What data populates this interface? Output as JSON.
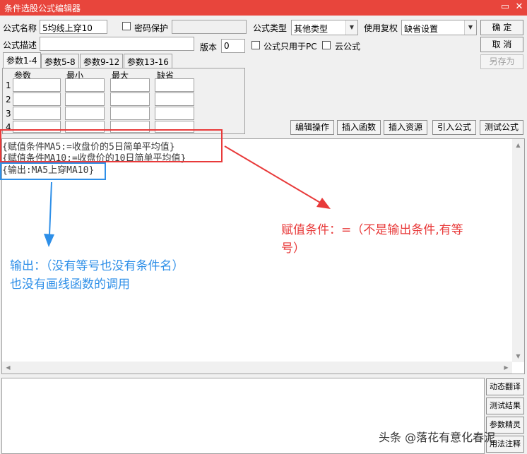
{
  "window": {
    "title": "条件选股公式编辑器",
    "minimize_glyph": "▭",
    "close_glyph": "✕"
  },
  "form": {
    "name_label": "公式名称",
    "name_value": "5均线上穿10",
    "password_label": "密码保护",
    "password_value": "",
    "type_label": "公式类型",
    "type_value": "其他类型",
    "fuquan_label": "使用复权",
    "fuquan_value": "缺省设置",
    "desc_label": "公式描述",
    "desc_value": "",
    "version_label": "版本",
    "version_value": "0",
    "pc_only_label": "公式只用于PC",
    "cloud_label": "云公式"
  },
  "buttons": {
    "ok": "确  定",
    "cancel": "取  消",
    "save_as": "另存为",
    "edit_ops": "编辑操作",
    "insert_func": "插入函数",
    "insert_res": "插入资源",
    "import_formula": "引入公式",
    "test_formula": "测试公式"
  },
  "param_tabs": [
    "参数1-4",
    "参数5-8",
    "参数9-12",
    "参数13-16"
  ],
  "param_table": {
    "headers": [
      "参数",
      "最小",
      "最大",
      "缺省"
    ],
    "rows": [
      "1",
      "2",
      "3",
      "4"
    ]
  },
  "code_lines": [
    "{赋值条件MA5:=收盘价的5日简单平均值}",
    "{赋值条件MA10:=收盘价的10日简单平均值}",
    "{输出:MA5上穿MA10}"
  ],
  "annotations": {
    "red_note_line1": "赋值条件：=（不是输出条件,有等",
    "red_note_line2": "号）",
    "blue_note_line1": "输出：（没有等号也没有条件名）",
    "blue_note_line2": "也没有画线函数的调用",
    "red_color": "#e83a3a",
    "blue_color": "#2e8fe8"
  },
  "side_buttons": [
    "动态翻译",
    "测试结果",
    "参数精灵",
    "用法注释"
  ],
  "watermark": "头条 @落花有意化春泥"
}
